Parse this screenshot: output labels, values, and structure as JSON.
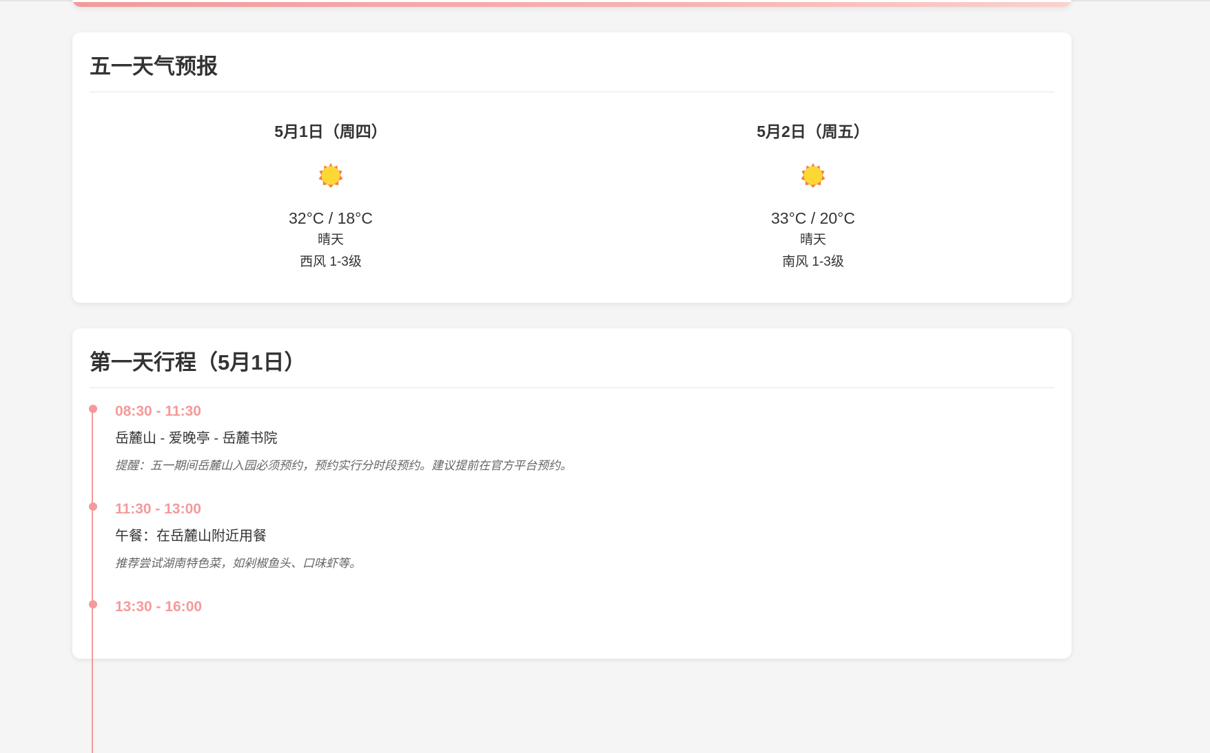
{
  "weather": {
    "title": "五一天气预报",
    "days": [
      {
        "date": "5月1日（周四）",
        "icon": "sun-icon",
        "temp": "32°C / 18°C",
        "condition": "晴天",
        "wind": "西风 1-3级"
      },
      {
        "date": "5月2日（周五）",
        "icon": "sun-icon",
        "temp": "33°C / 20°C",
        "condition": "晴天",
        "wind": "南风 1-3级"
      }
    ]
  },
  "itinerary": {
    "title": "第一天行程（5月1日）",
    "items": [
      {
        "time": "08:30 - 11:30",
        "activity": "岳麓山 - 爱晚亭 - 岳麓书院",
        "note": "提醒：五一期间岳麓山入园必须预约，预约实行分时段预约。建议提前在官方平台预约。"
      },
      {
        "time": "11:30 - 13:00",
        "activity": "午餐：在岳麓山附近用餐",
        "note": "推荐尝试湖南特色菜，如剁椒鱼头、口味虾等。"
      },
      {
        "time": "13:30 - 16:00"
      }
    ]
  },
  "colors": {
    "accent": "#f49a9a",
    "sun_fill": "#fdd835",
    "sun_stroke": "#f57c3a",
    "background": "#f5f5f5",
    "card": "#ffffff"
  }
}
